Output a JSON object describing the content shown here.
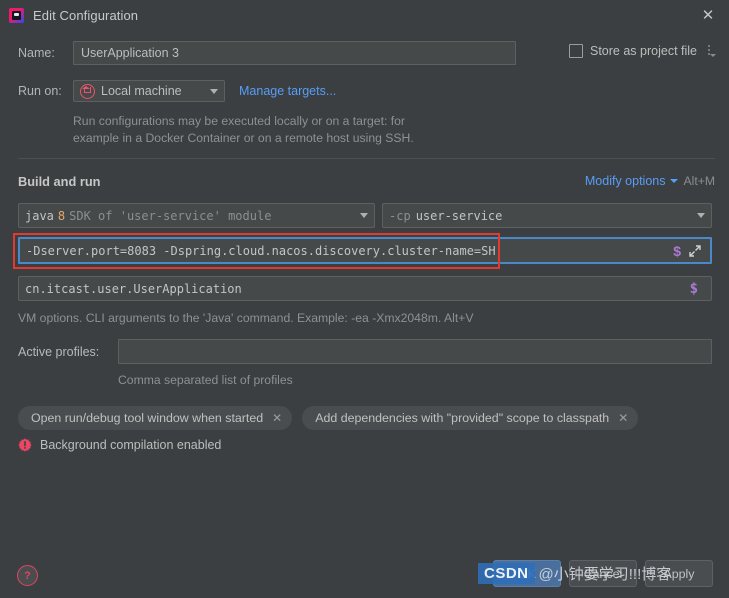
{
  "window": {
    "title": "Edit Configuration",
    "app_icon": "intellij-idea-icon",
    "close_icon": "close-icon"
  },
  "name_row": {
    "label": "Name:",
    "value": "UserApplication 3",
    "placeholder": ""
  },
  "store_as_project_file": {
    "label": "Store as project file",
    "checked": false,
    "overflow_icon": "kebab-menu-icon"
  },
  "run_on": {
    "label": "Run on:",
    "target_icon": "local-machine-home-icon",
    "value": "Local machine",
    "manage_link": "Manage targets...",
    "hint_line1": "Run configurations may be executed locally or on a target: for",
    "hint_line2": "example in a Docker Container or on a remote host using SSH."
  },
  "build_and_run": {
    "section_title": "Build and run",
    "modify_options_label": "Modify options",
    "modify_options_shortcut": "Alt+M",
    "jdk": {
      "prefix": "java",
      "version": "8",
      "suffix": "SDK of 'user-service' module"
    },
    "classpath": {
      "prefix": "-cp",
      "value": "user-service"
    },
    "vm_options": {
      "value": "-Dserver.port=8083 -Dspring.cloud.nacos.discovery.cluster-name=SH",
      "macro_icon": "macro-dollar-icon",
      "expand_icon": "expand-arrows-icon",
      "focused": true,
      "annotation": "red-highlight-box"
    },
    "main_class": {
      "value": "cn.itcast.user.UserApplication",
      "macro_icon": "macro-dollar-icon"
    },
    "vm_hint": "VM options. CLI arguments to the 'Java' command. Example: -ea -Xmx2048m. Alt+V"
  },
  "active_profiles": {
    "label": "Active profiles:",
    "value": "",
    "hint": "Comma separated list of profiles"
  },
  "option_chips": [
    {
      "label": "Open run/debug tool window when started",
      "remove_icon": "close-icon"
    },
    {
      "label": "Add dependencies with \"provided\" scope to classpath",
      "remove_icon": "close-icon"
    }
  ],
  "status": {
    "icon": "warning-badge-icon",
    "text": "Background compilation enabled"
  },
  "footer": {
    "help_icon": "help-question-icon",
    "buttons": [
      {
        "label": "OK",
        "primary": true
      },
      {
        "label": "Cancel",
        "primary": false
      },
      {
        "label": "Apply",
        "primary": false
      }
    ]
  },
  "watermark": {
    "badge": "CSDN",
    "text": "@小钟要学习!!!博客"
  },
  "colors": {
    "background": "#3c3f41",
    "field_background": "#45494a",
    "border": "#5e6060",
    "link": "#589df6",
    "focus_border": "#4a88c7",
    "annotation_red": "#e23a2e",
    "macro_purple": "#a97ad1",
    "accent_red": "#e2455f",
    "watermark_blue": "#2e6eb8"
  }
}
